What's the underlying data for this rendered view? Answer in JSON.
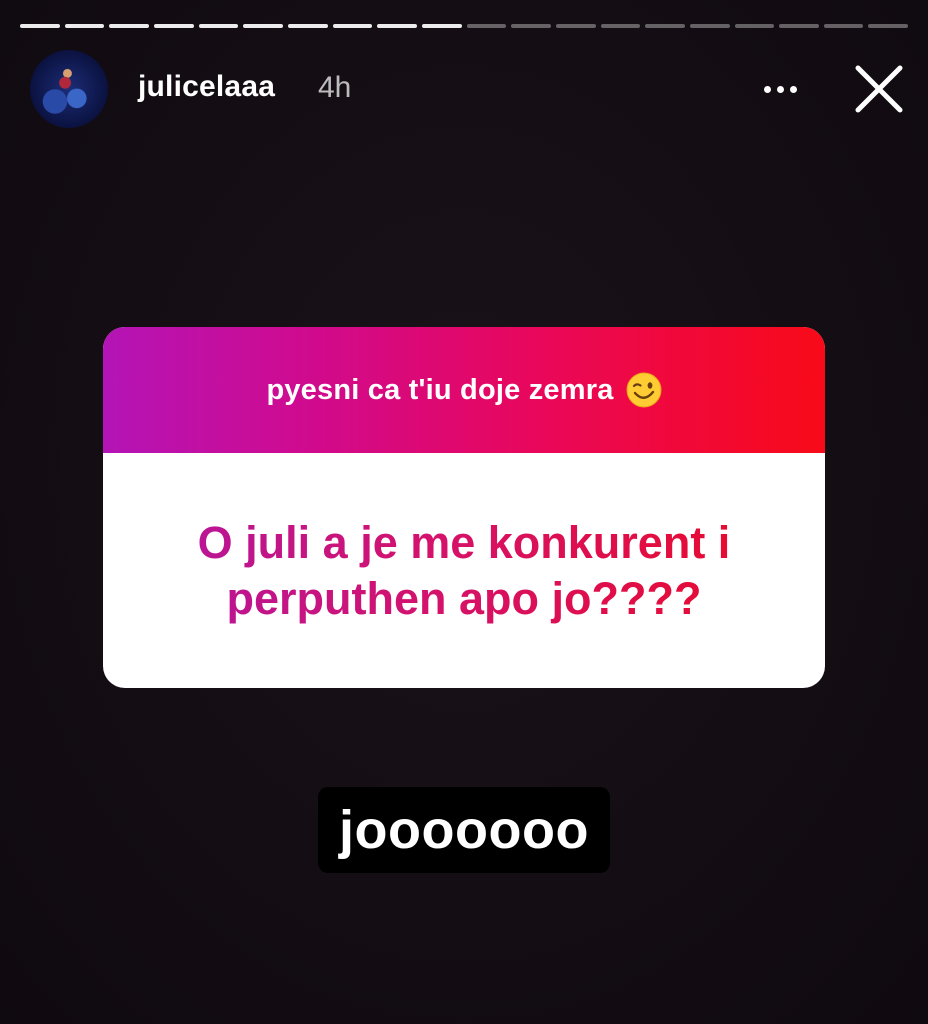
{
  "story": {
    "progress": {
      "segments": 20,
      "completed": 10
    }
  },
  "header": {
    "username": "julicelaaa",
    "time": "4h",
    "more_icon": "more-horizontal-icon",
    "close_icon": "close-icon"
  },
  "question_sticker": {
    "prompt": "pyesni ca t'iu doje zemra",
    "prompt_emoji": "wink-emoji-icon",
    "question": "O juli a je me konkurent i perputhen apo jo????",
    "colors": {
      "gradient_start": "#b414b6",
      "gradient_end": "#f80a18"
    }
  },
  "answer": {
    "text": "jooooooo"
  }
}
